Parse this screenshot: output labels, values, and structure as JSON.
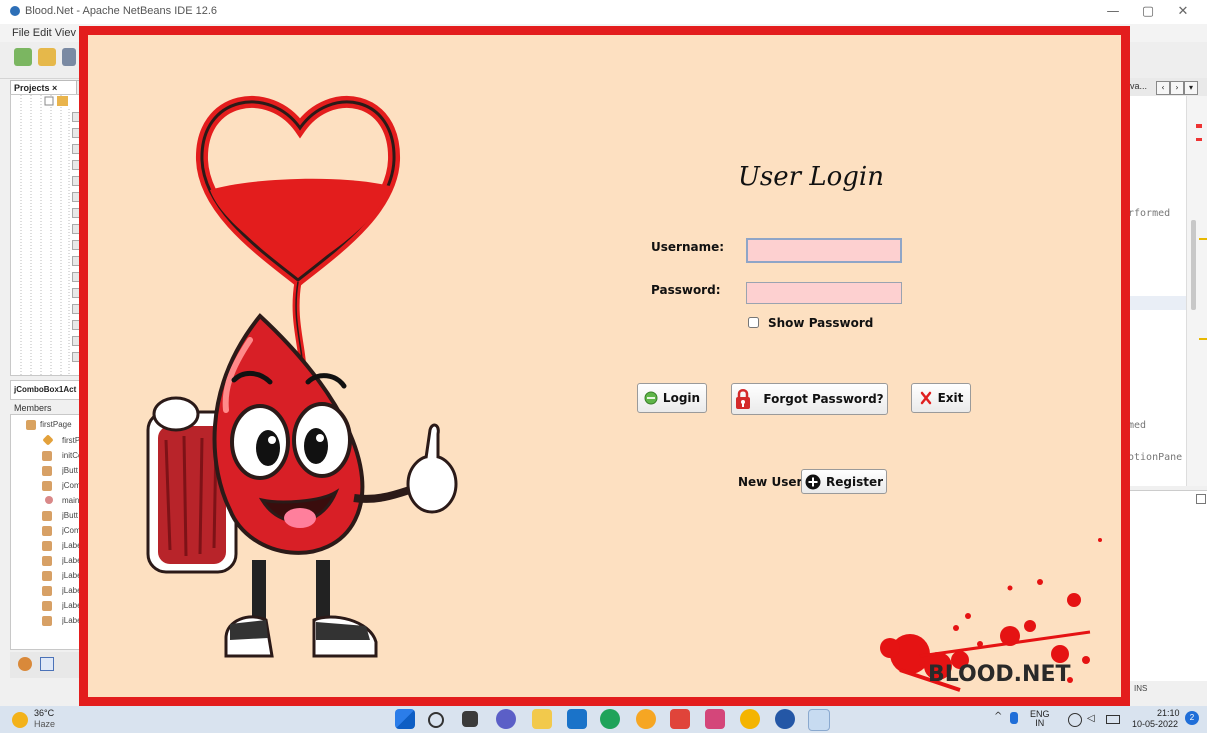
{
  "ide": {
    "title": "Blood.Net - Apache NetBeans IDE 12.6",
    "menu": "File  Edit  Viev",
    "projects_tab": "Projects ×",
    "navigator_tab": "jComboBox1Act",
    "members_label": "Members",
    "members": [
      "firstPage",
      "firstP",
      "initCo",
      "jButt",
      "jCom",
      "main",
      "jButt",
      "jCom",
      "jLabe",
      "jLabe",
      "jLabe",
      "jLabe",
      "jLabe",
      "jLabe"
    ],
    "right_tab": "va...",
    "code_fragments": [
      "rformed",
      "med",
      "otionPane"
    ],
    "status": "INS",
    "window_controls": [
      "—",
      "▢",
      "✕"
    ]
  },
  "login": {
    "title": "User Login",
    "username_label": "Username:",
    "username_value": "",
    "password_label": "Password:",
    "password_value": "",
    "show_password_label": "Show Password",
    "login_button": "Login",
    "forgot_button": "Forgot Password?",
    "exit_button": "Exit",
    "new_user_label": "New User?",
    "register_button": "Register",
    "brand": "BLOOD.NET",
    "colors": {
      "frame": "#e31d1d",
      "background": "#fde0c1",
      "field": "#fdd0d0"
    }
  },
  "taskbar": {
    "temperature": "36°C",
    "weather": "Haze",
    "lang_top": "ENG",
    "lang_bottom": "IN",
    "time": "21:10",
    "date": "10-05-2022",
    "notifications": "2"
  }
}
